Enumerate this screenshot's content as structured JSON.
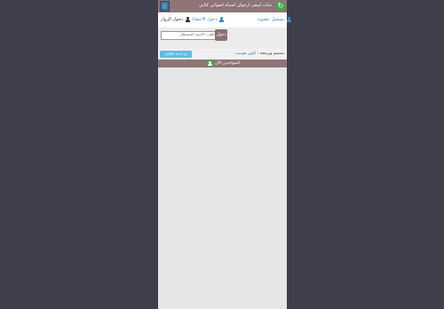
{
  "header": {
    "title": "شات ليبقى ارجوان لسناه اصواتي كتابي",
    "refresh_icon": "refresh-icon"
  },
  "nav": {
    "register_label": "تسجيل عضويه",
    "members_label": "دخول الاعضاء",
    "visitors_label": "دخول الزوار"
  },
  "login": {
    "name_placeholder": "اللقب الاسم المستعار",
    "login_label": "دخول"
  },
  "credit": {
    "install_label": "تم اعداد الكامل",
    "prefix": "تصميم وبرمجة :",
    "link": "ابلون هوست"
  },
  "online": {
    "label": "المتواجدين الآن"
  },
  "colors": {
    "background": "#3f3f4b",
    "panel": "#e6e6e6",
    "bar": "#8f7575",
    "accent_green": "#42a94b",
    "accent_blue": "#3a87c2",
    "info": "#5bc0de"
  }
}
